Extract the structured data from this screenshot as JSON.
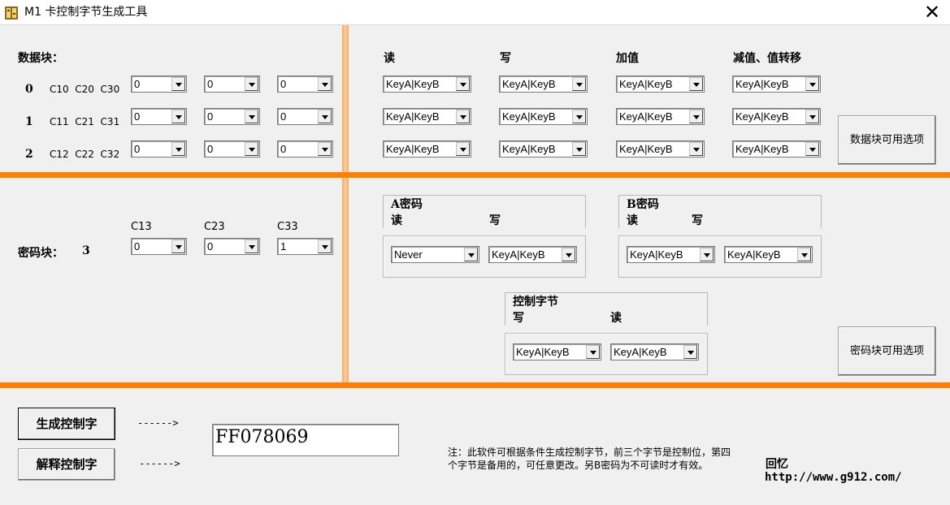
{
  "window": {
    "title": "M1 卡控制字节生成工具",
    "close_symbol": "✕"
  },
  "data_block": {
    "label": "数据块：",
    "rows": [
      {
        "num": "0",
        "cbits": "C10  C20  C30",
        "values": [
          "0",
          "0",
          "0"
        ]
      },
      {
        "num": "1",
        "cbits": "C11  C21  C31",
        "values": [
          "0",
          "0",
          "0"
        ]
      },
      {
        "num": "2",
        "cbits": "C12  C22  C32",
        "values": [
          "0",
          "0",
          "0"
        ]
      }
    ],
    "perm_headers": [
      "读",
      "写",
      "加值",
      "减值、值转移"
    ],
    "perm_rows": [
      [
        "KeyA|KeyB",
        "KeyA|KeyB",
        "KeyA|KeyB",
        "KeyA|KeyB"
      ],
      [
        "KeyA|KeyB",
        "KeyA|KeyB",
        "KeyA|KeyB",
        "KeyA|KeyB"
      ],
      [
        "KeyA|KeyB",
        "KeyA|KeyB",
        "KeyA|KeyB",
        "KeyA|KeyB"
      ]
    ],
    "options_button": "数据块可用选项"
  },
  "key_block": {
    "label": "密码块：",
    "num": "3",
    "cbit_headers": [
      "C13",
      "C23",
      "C33"
    ],
    "values": [
      "0",
      "0",
      "1"
    ],
    "key_a": {
      "title": "A密码",
      "read_label": "读",
      "write_label": "写",
      "read": "Never",
      "write": "KeyA|KeyB"
    },
    "key_b": {
      "title": "B密码",
      "read_label": "读",
      "write_label": "写",
      "read": "KeyA|KeyB",
      "write": "KeyA|KeyB"
    },
    "control": {
      "title": "控制字节",
      "write_label": "写",
      "read_label": "读",
      "write": "KeyA|KeyB",
      "read": "KeyA|KeyB"
    },
    "options_button": "密码块可用选项"
  },
  "bottom": {
    "generate_button": "生成控制字",
    "parse_button": "解释控制字",
    "arrow1": "------>",
    "arrow2": "------>",
    "output_value": "FF078069",
    "note_line1": "注：此软件可根据条件生成控制字节，前三个字节是控制位，第四",
    "note_line2": "个字节是备用的，可任意更改。另B密码为不可读时才有效。",
    "author": "回忆",
    "url": "http://www.g912.com/"
  },
  "colors": {
    "accent_bar": "#ff8000",
    "vertical_bar": "#f6c898",
    "background": "#f0f0f0"
  },
  "icons": [
    "app-icon",
    "dropdown-arrow-icon",
    "close-icon"
  ]
}
